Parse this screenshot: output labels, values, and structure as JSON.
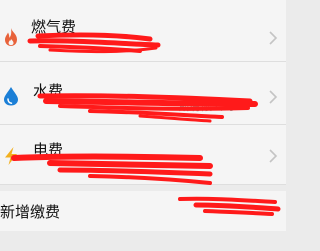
{
  "rows": [
    {
      "title": "燃气费",
      "icon": "flame-icon",
      "icon_color": "#e8623a"
    },
    {
      "title": "水费",
      "icon": "water-drop-icon",
      "icon_color": "#1b7fd6",
      "subtext": "…所有限公司"
    },
    {
      "title": "电费",
      "icon": "lightning-icon",
      "icon_color": "#f2b01e"
    }
  ],
  "new_payment": {
    "label": "新增缴费"
  },
  "colors": {
    "redaction": "#ff1a1a",
    "chevron": "#c4c4c4"
  }
}
